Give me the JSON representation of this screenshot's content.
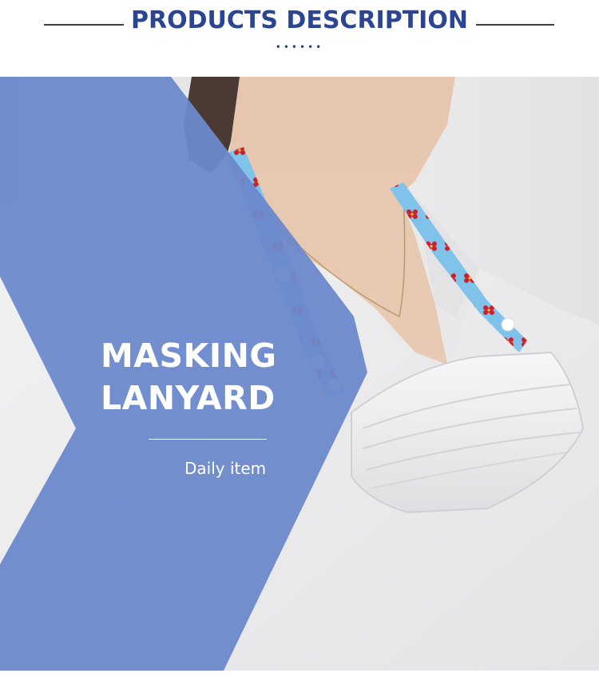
{
  "header": {
    "title": "PRODUCTS DESCRIPTION",
    "dots": "••••••"
  },
  "hero": {
    "title_line1": "MASKING",
    "title_line2": "LANYARD",
    "subtitle": "Daily item"
  },
  "colors": {
    "brand": "#2b4592",
    "overlay_blue": "#6c89cb",
    "lanyard_blue": "#7fc2ea",
    "flower_red": "#d11f2a"
  }
}
